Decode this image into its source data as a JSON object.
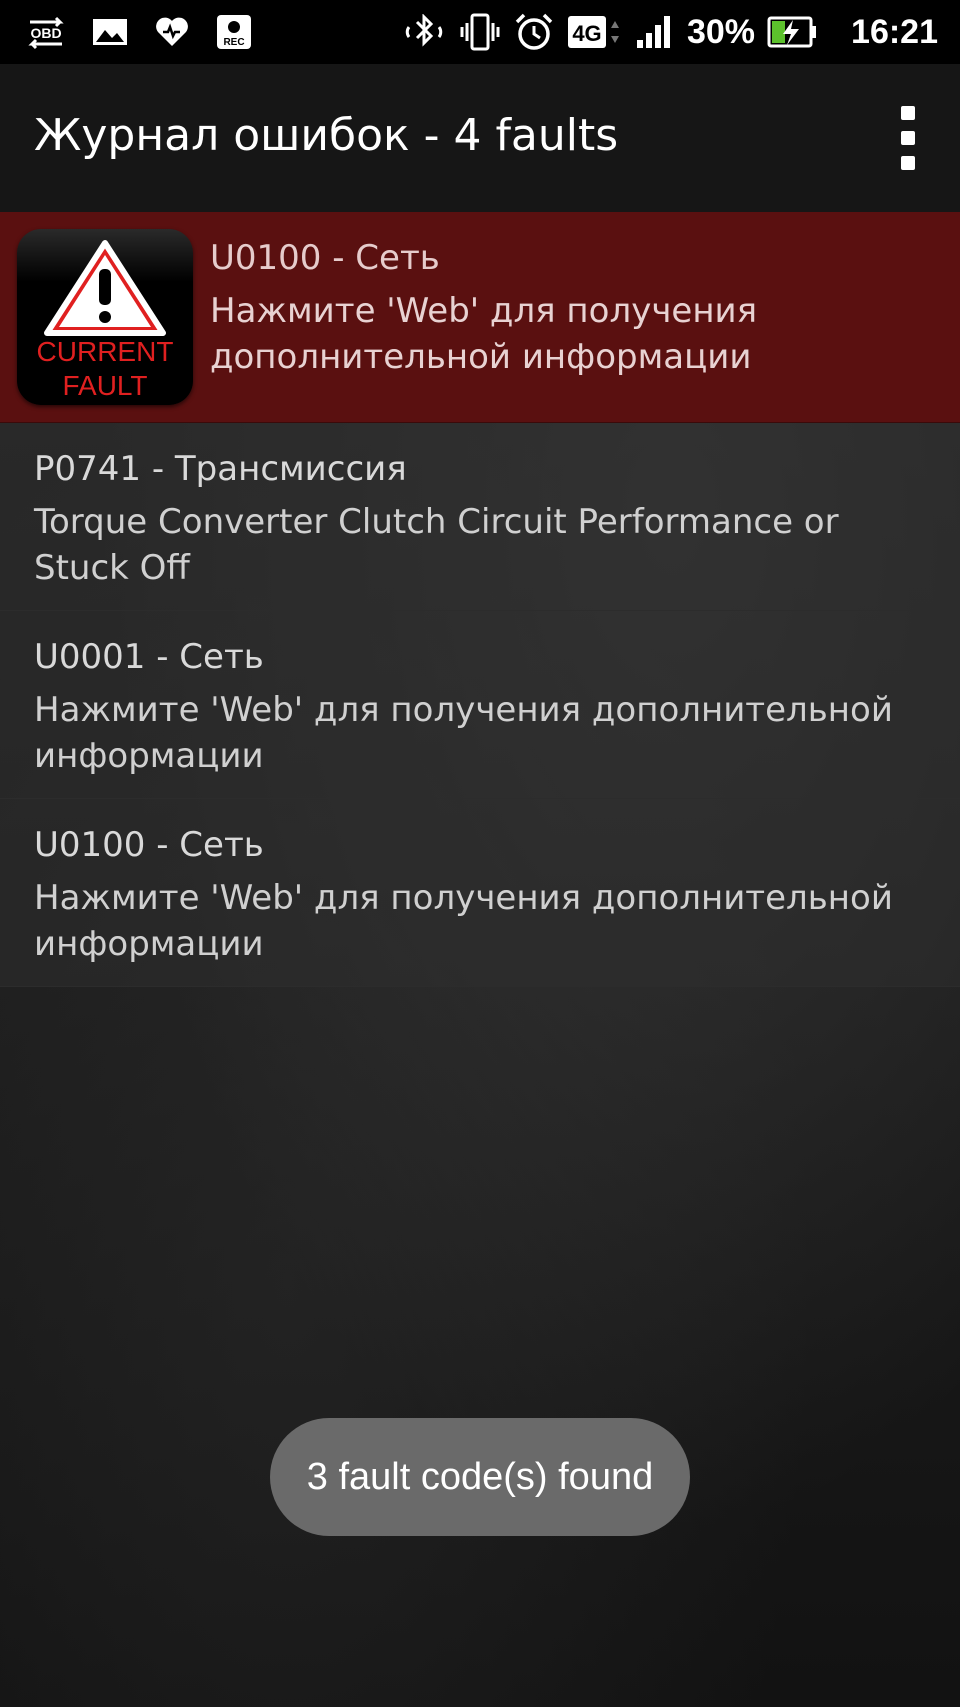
{
  "status_bar": {
    "left_icons": [
      "obd-icon",
      "image-icon",
      "heart-icon",
      "rec-icon"
    ],
    "obd_label": "OBD",
    "rec_label": "REC",
    "network": "4G",
    "battery": "30%",
    "time": "16:21"
  },
  "action_bar": {
    "title": "Журнал ошибок - 4 faults",
    "overflow_icon": "overflow-menu-icon"
  },
  "current_fault_icon": {
    "line1": "CURRENT",
    "line2": "FAULT"
  },
  "faults": [
    {
      "code": "U0100 - Сеть",
      "description": "Нажмите 'Web' для получения дополнительной информации",
      "current": true
    },
    {
      "code": "P0741 - Трансмиссия",
      "description": "Torque Converter Clutch Circuit Performance or Stuck Off",
      "current": false
    },
    {
      "code": "U0001 - Сеть",
      "description": "Нажмите 'Web' для получения дополнительной информации",
      "current": false
    },
    {
      "code": "U0100 - Сеть",
      "description": "Нажмите 'Web' для получения дополнительной информации",
      "current": false
    }
  ],
  "toast": {
    "message": "3 fault code(s) found"
  },
  "colors": {
    "current_row": "#5a1010",
    "warning_red": "#e02020",
    "battery_green": "#5cc12c"
  }
}
